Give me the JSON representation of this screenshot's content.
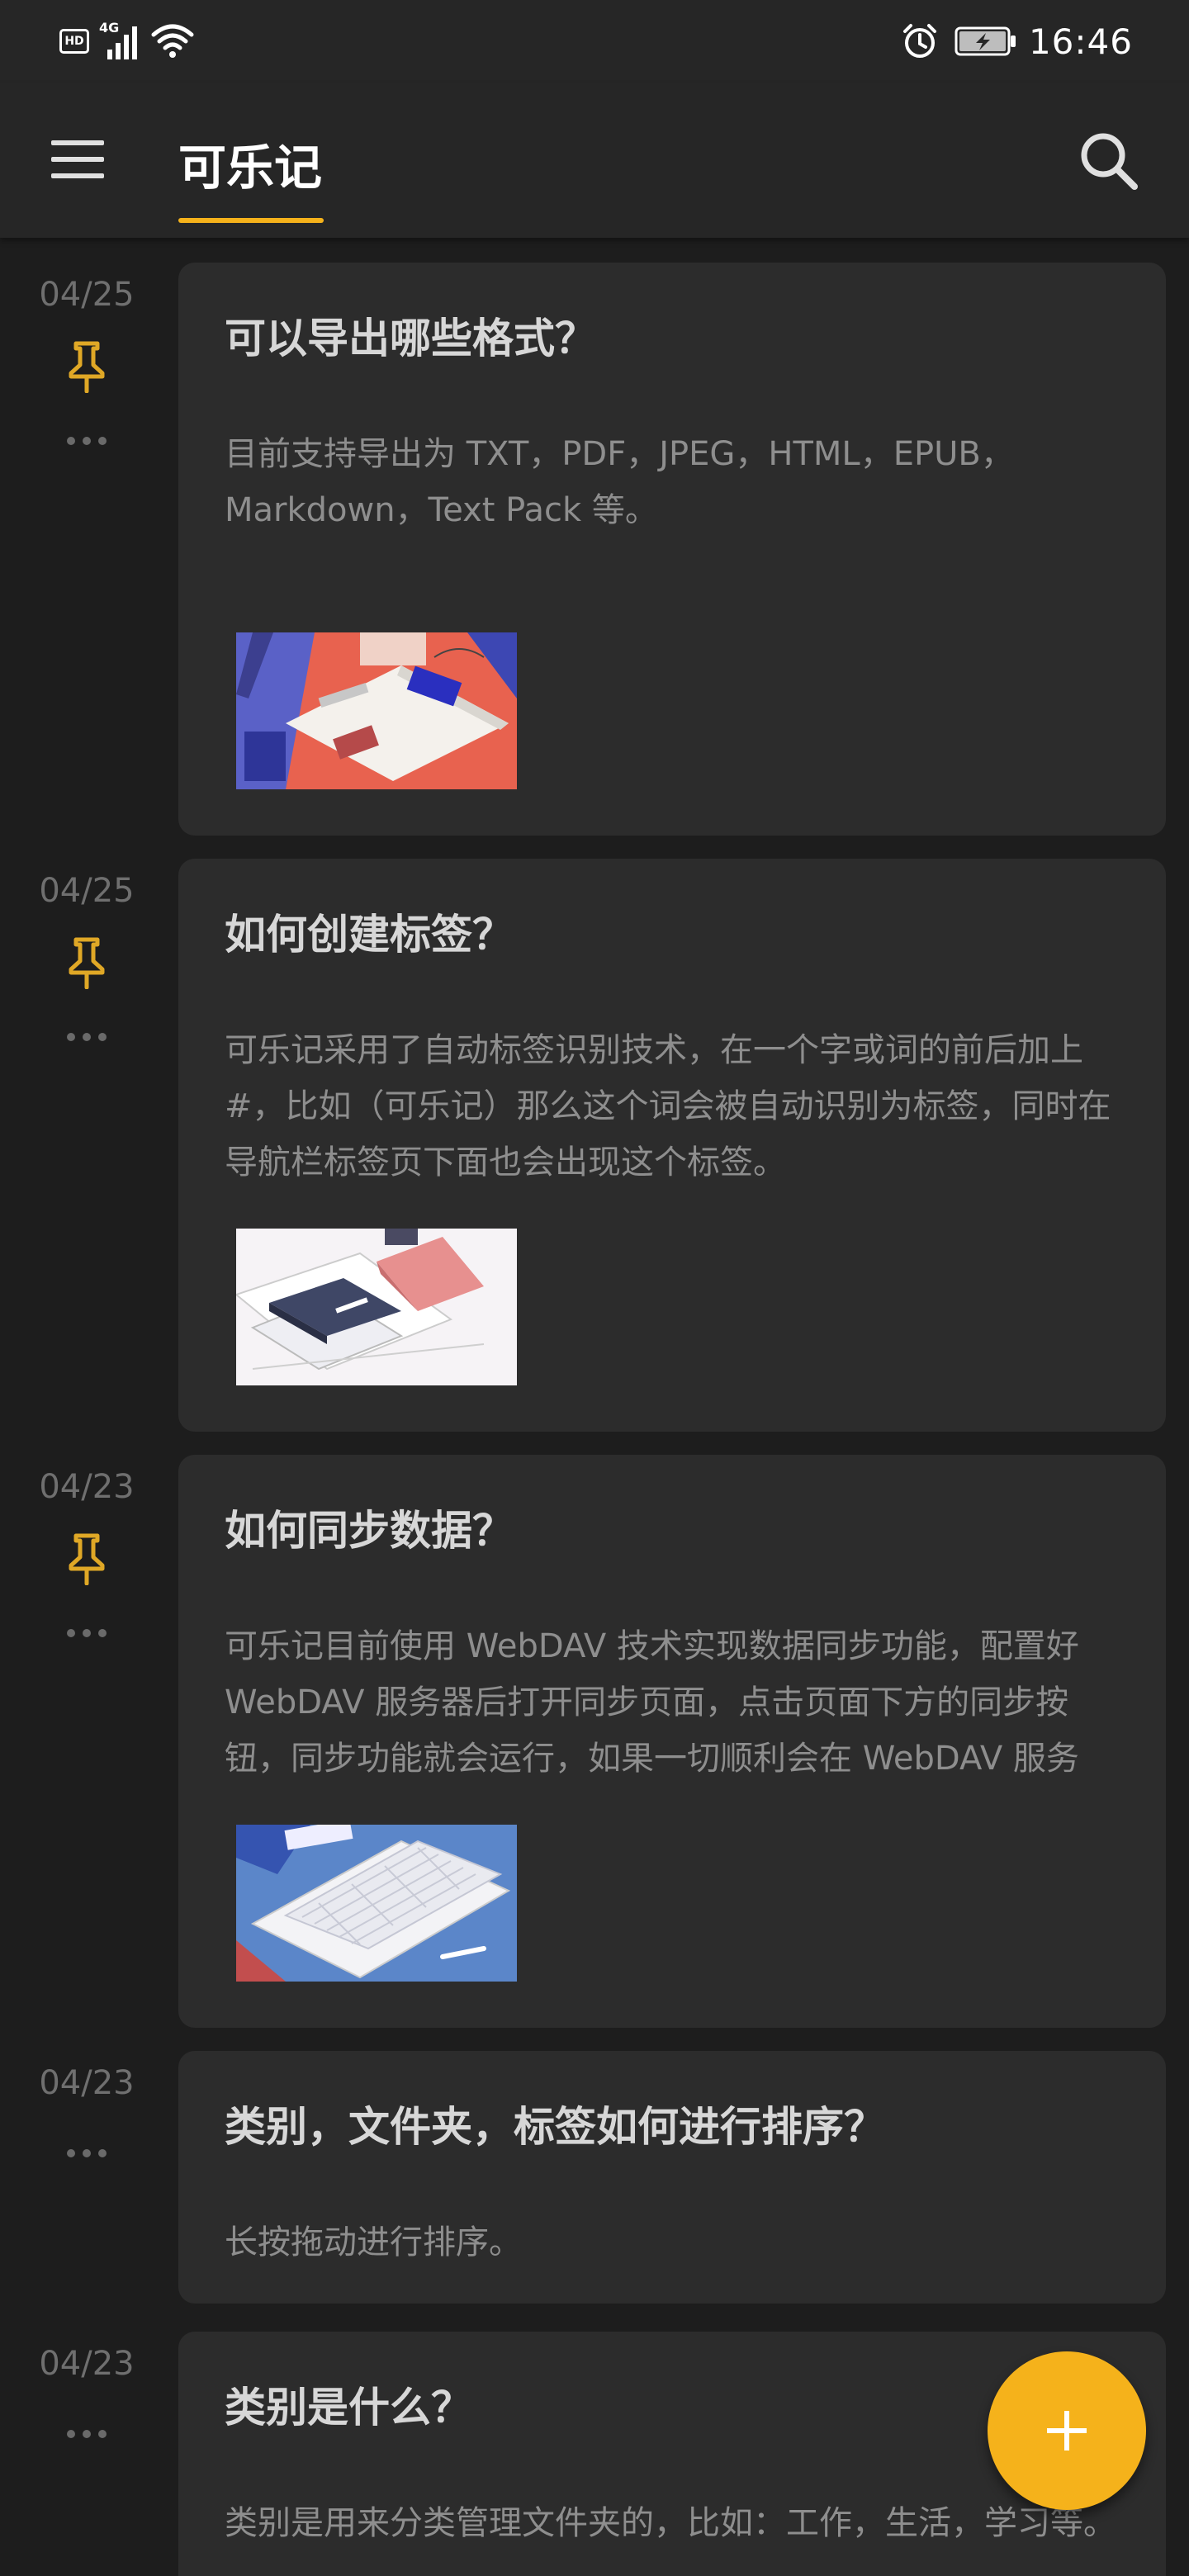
{
  "status_bar": {
    "hd_label": "HD",
    "network_label": "4G",
    "time": "16:46"
  },
  "app_bar": {
    "title": "可乐记",
    "accent_color": "#f5b21b"
  },
  "notes": [
    {
      "date": "04/25",
      "pinned": true,
      "title": "可以导出哪些格式？",
      "body": "目前支持导出为 TXT，PDF，JPEG，HTML，EPUB，Markdown，Text Pack 等。",
      "thumbnail": "export-illustration"
    },
    {
      "date": "04/25",
      "pinned": true,
      "title": "如何创建标签？",
      "body": "可乐记采用了自动标签识别技术，在一个字或词的前后加上 #，比如（可乐记）那么这个词会被自动识别为标签，同时在导航栏标签页下面也会出现这个标签。",
      "thumbnail": "notebook-illustration"
    },
    {
      "date": "04/23",
      "pinned": true,
      "title": "如何同步数据？",
      "body": "可乐记目前使用 WebDAV 技术实现数据同步功能，配置好 WebDAV 服务器后打开同步页面，点击页面下方的同步按钮，同步功能就会运行，如果一切顺利会在 WebDAV 服务",
      "thumbnail": "keyboard-illustration"
    },
    {
      "date": "04/23",
      "pinned": false,
      "title": "类别，文件夹，标签如何进行排序？",
      "body": "长按拖动进行排序。",
      "thumbnail": ""
    },
    {
      "date": "04/23",
      "pinned": false,
      "title": "类别是什么？",
      "body": "类别是用来分类管理文件夹的，比如：工作，生活，学习等。",
      "thumbnail": ""
    }
  ],
  "fab": {
    "icon": "plus-icon",
    "color": "#f5b21b"
  }
}
